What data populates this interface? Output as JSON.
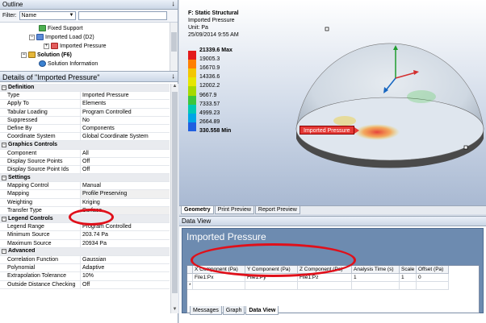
{
  "outline": {
    "title": "Outline",
    "filter_label": "Filter:",
    "filter_value": "Name",
    "tree": [
      {
        "label": "Fixed Support",
        "icon": "fixed-support-icon"
      },
      {
        "label": "Imported Load (D2)",
        "icon": "imported-load-icon"
      },
      {
        "label": "Imported Pressure",
        "icon": "imported-pressure-icon"
      },
      {
        "label": "Solution (F6)",
        "icon": "solution-icon"
      },
      {
        "label": "Solution Information",
        "icon": "info-icon"
      }
    ]
  },
  "details": {
    "title": "Details of \"Imported Pressure\"",
    "rows": [
      {
        "section": "Definition"
      },
      {
        "key": "Type",
        "value": "Imported Pressure"
      },
      {
        "key": "Apply To",
        "value": "Elements"
      },
      {
        "key": "Tabular Loading",
        "value": "Program Controlled"
      },
      {
        "key": "Suppressed",
        "value": "No"
      },
      {
        "key": "Define By",
        "value": "Components"
      },
      {
        "key": "Coordinate System",
        "value": "Global Coordinate System"
      },
      {
        "section": "Graphics Controls"
      },
      {
        "key": "Component",
        "value": "All"
      },
      {
        "key": "Display Source Points",
        "value": "Off"
      },
      {
        "key": "Display Source Point Ids",
        "value": "Off"
      },
      {
        "section": "Settings"
      },
      {
        "key": "Mapping Control",
        "value": "Manual"
      },
      {
        "key": "Mapping",
        "value": "Profile Preserving"
      },
      {
        "key": "Weighting",
        "value": "Kriging"
      },
      {
        "key": "Transfer Type",
        "value": "Surface"
      },
      {
        "section": "Legend Controls"
      },
      {
        "key": "Legend Range",
        "value": "Program Controlled"
      },
      {
        "key": "Minimum Source",
        "value": "203.74 Pa"
      },
      {
        "key": "Maximum Source",
        "value": "20934 Pa"
      },
      {
        "section": "Advanced"
      },
      {
        "key": "Correlation Function",
        "value": "Gaussian"
      },
      {
        "key": "Polynomial",
        "value": "Adaptive"
      },
      {
        "key": "Extrapolation Tolerance",
        "value": "10%"
      },
      {
        "key": "Outside Distance Checking",
        "value": "Off"
      }
    ]
  },
  "graphics": {
    "header": "F: Static Structural",
    "subtitle": "Imported Pressure",
    "unit": "Unit: Pa",
    "timestamp": "25/09/2014 9:55 AM",
    "legend": [
      {
        "label": "21339.6 Max",
        "color": "#e31a1c"
      },
      {
        "label": "19005.3",
        "color": "#ff7f00"
      },
      {
        "label": "16670.9",
        "color": "#f3c600"
      },
      {
        "label": "14336.6",
        "color": "#e6e600"
      },
      {
        "label": "12002.2",
        "color": "#a6d900"
      },
      {
        "label": "9667.9",
        "color": "#3cc63c"
      },
      {
        "label": "7333.57",
        "color": "#00c8b4"
      },
      {
        "label": "4999.23",
        "color": "#00a5e6"
      },
      {
        "label": "2664.89",
        "color": "#1f5fe0"
      },
      {
        "label": "330.558 Min",
        "color": "#0a14d0"
      }
    ],
    "tag_label": "Imported Pressure",
    "tabs": [
      "Geometry",
      "Print Preview",
      "Report Preview"
    ]
  },
  "data_view": {
    "title": "Data View",
    "panel_title": "Imported Pressure",
    "columns": [
      "X Component (Pa)",
      "Y Component (Pa)",
      "Z Component (Pa)",
      "Analysis Time (s)",
      "Scale",
      "Offset (Pa)"
    ],
    "rows": [
      {
        "marker": "",
        "cells": [
          "File1:Px",
          "File1:Py",
          "File1:Pz",
          "1",
          "1",
          "0"
        ]
      },
      {
        "marker": "*",
        "cells": [
          "",
          "",
          "",
          "",
          "",
          ""
        ]
      }
    ],
    "tabs": [
      "Messages",
      "Graph",
      "Data View"
    ]
  }
}
